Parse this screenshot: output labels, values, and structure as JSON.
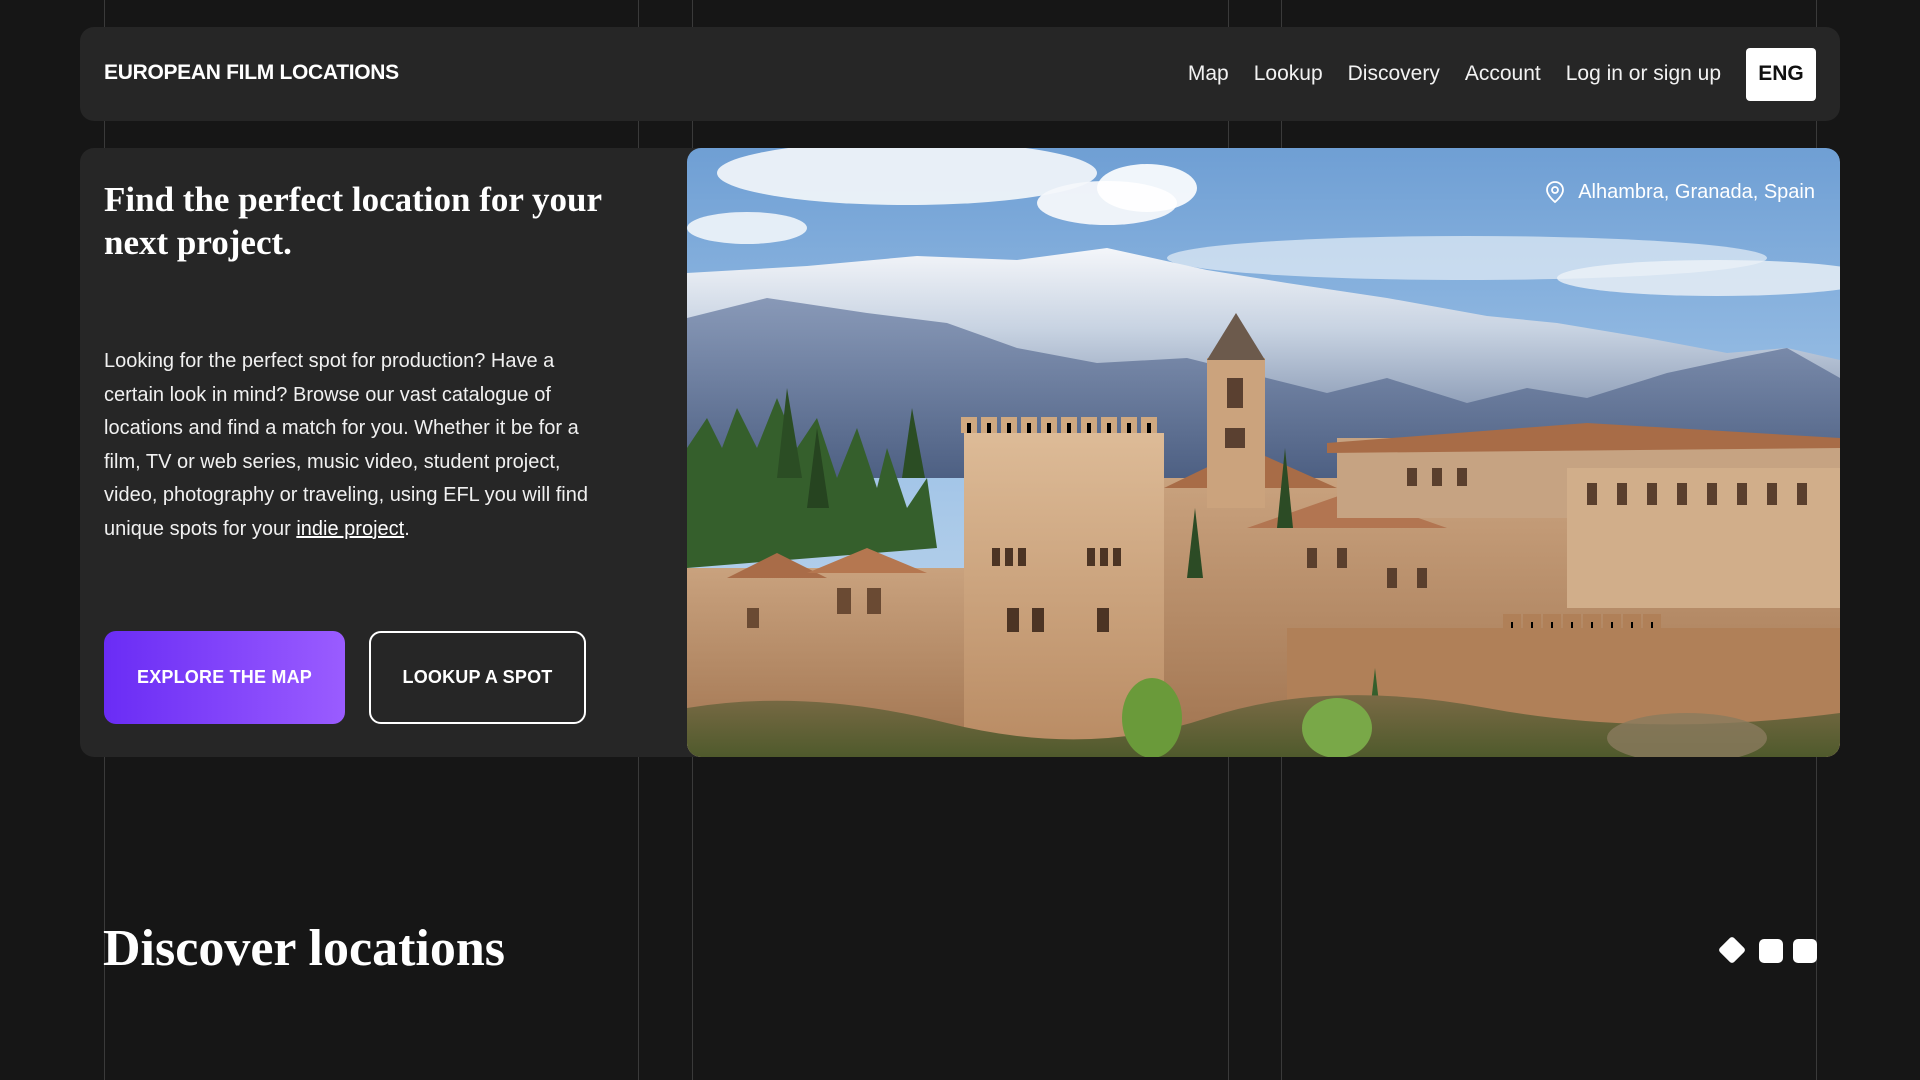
{
  "header": {
    "logo": "EUROPEAN FILM LOCATIONS",
    "nav": [
      "Map",
      "Lookup",
      "Discovery",
      "Account",
      "Log in or sign up"
    ],
    "language": "ENG"
  },
  "hero": {
    "title": "Find the perfect location for your next project.",
    "body_text": "Looking for the perfect spot for production? Have a certain look in mind? Browse our vast catalogue of locations and find a match for you. Whether it be for a film, TV or web series, music video, student project, video, photography or traveling, using EFL you will find unique spots for your ",
    "body_link": "indie project",
    "body_end": ".",
    "primary_button": "EXPLORE THE MAP",
    "secondary_button": "LOOKUP A SPOT",
    "image_location": "Alhambra, Granada, Spain",
    "location_icon": "map-pin-icon"
  },
  "discover": {
    "title": "Discover locations"
  },
  "colors": {
    "background": "#161616",
    "panel": "#262626",
    "accent_start": "#6a2cf5",
    "accent_end": "#9a5cff",
    "card_accent": "#c870c8"
  }
}
